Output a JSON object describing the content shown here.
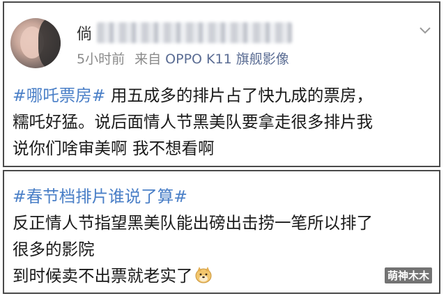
{
  "post1": {
    "username_visible": "倘",
    "time": "5小时前",
    "source": "来自",
    "device": "OPPO K11 旗舰影像",
    "topic": "#哪吒票房#",
    "text_line1": " 用五成多的排片占了快九成的票房，",
    "text_line2": "糯吒好猛。说后面情人节黑美队要拿走很多排片我",
    "text_line3": "说你们啥审美啊 我不想看啊"
  },
  "post2": {
    "topic": "#春节档排片谁说了算#",
    "text_line1": "反正情人节指望黑美队能出磅出击捞一笔所以排了",
    "text_line2": "很多的影院",
    "text_line3": "到时候卖不出票就老实了",
    "emoji": "doge-emoji"
  },
  "watermark": "萌神木木",
  "colors": {
    "topic": "#4a7fc7",
    "meta": "#8a8a8a",
    "device": "#5a6c93",
    "border": "#4a4a4a"
  }
}
